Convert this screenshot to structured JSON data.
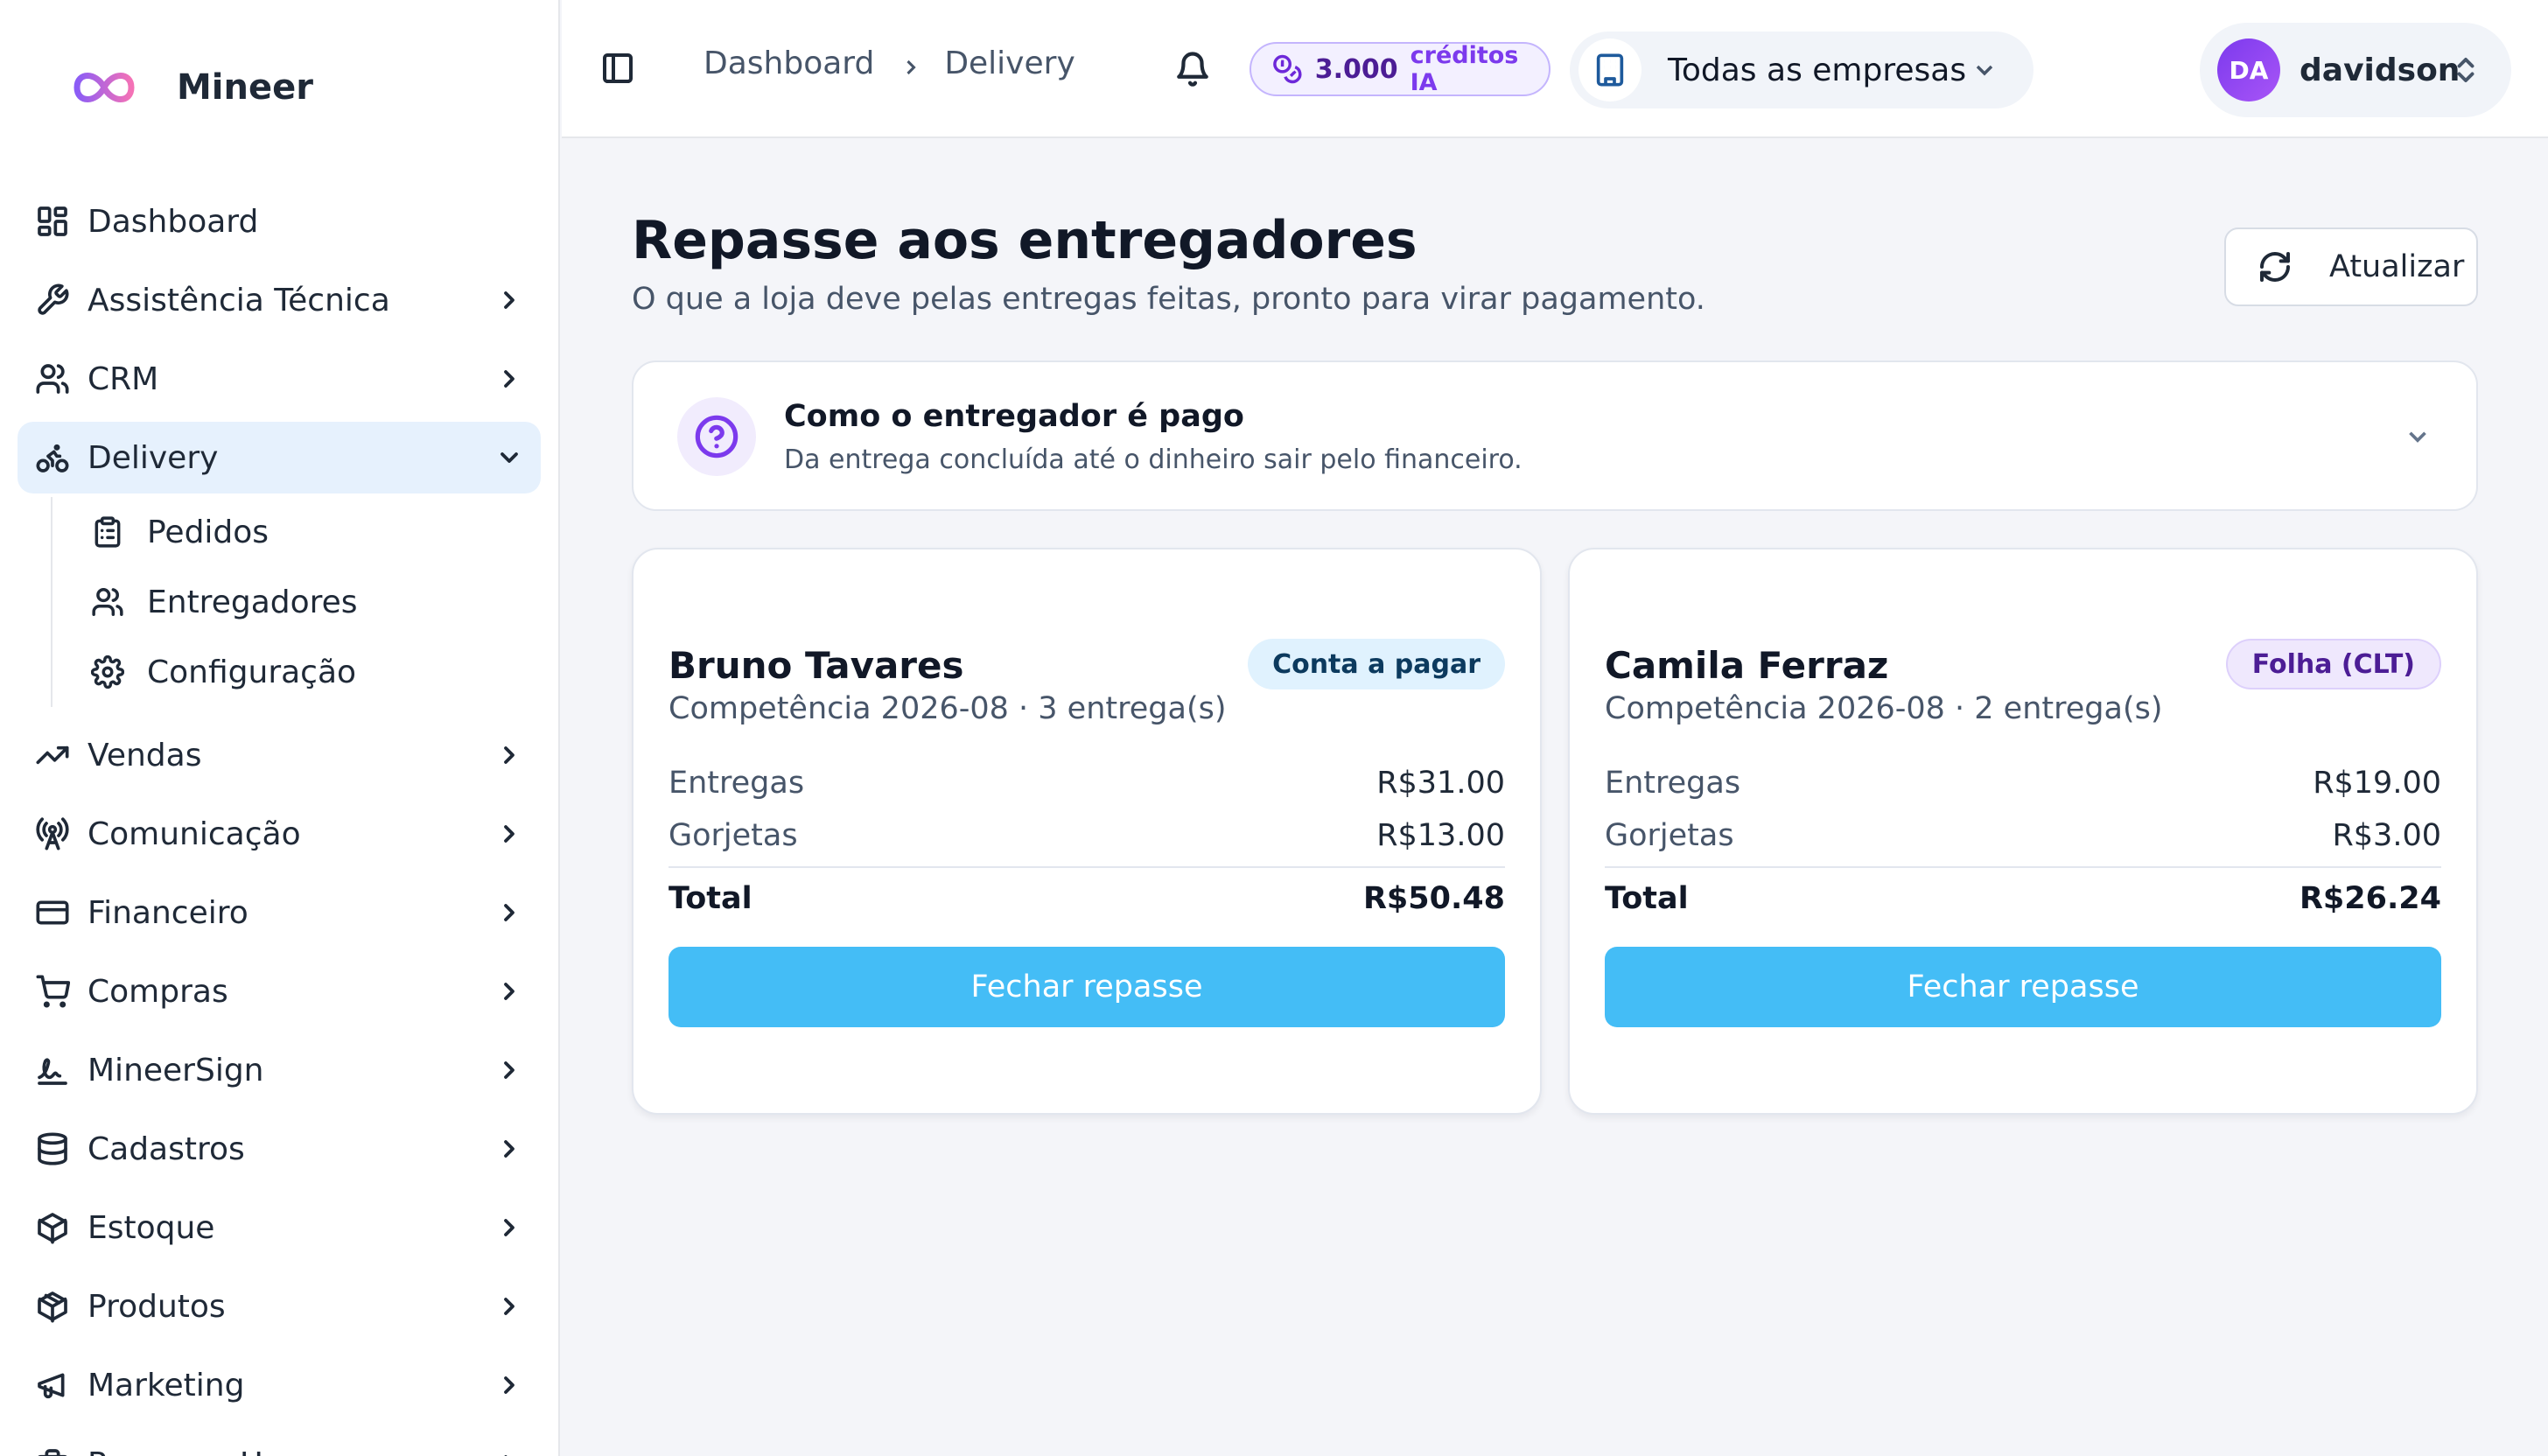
{
  "brand": {
    "name": "Mineer"
  },
  "sidebar": {
    "items": [
      {
        "label": "Dashboard",
        "icon": "layout-grid-icon"
      },
      {
        "label": "Assistência Técnica",
        "icon": "wrench-icon"
      },
      {
        "label": "CRM",
        "icon": "users-icon"
      },
      {
        "label": "Delivery",
        "icon": "bike-icon",
        "expanded": true,
        "children": [
          {
            "label": "Pedidos",
            "icon": "clipboard-icon"
          },
          {
            "label": "Entregadores",
            "icon": "users-icon"
          },
          {
            "label": "Configuração",
            "icon": "gear-icon"
          }
        ]
      },
      {
        "label": "Vendas",
        "icon": "trending-up-icon"
      },
      {
        "label": "Comunicação",
        "icon": "radio-tower-icon"
      },
      {
        "label": "Financeiro",
        "icon": "credit-card-icon"
      },
      {
        "label": "Compras",
        "icon": "shopping-cart-icon"
      },
      {
        "label": "MineerSign",
        "icon": "signature-icon"
      },
      {
        "label": "Cadastros",
        "icon": "database-icon"
      },
      {
        "label": "Estoque",
        "icon": "box-icon"
      },
      {
        "label": "Produtos",
        "icon": "package-icon"
      },
      {
        "label": "Marketing",
        "icon": "megaphone-icon"
      },
      {
        "label": "Recursos Humanos",
        "icon": "briefcase-icon"
      }
    ]
  },
  "topbar": {
    "breadcrumb": [
      "Dashboard",
      "Delivery"
    ],
    "credits": {
      "amount": "3.000",
      "label": "créditos IA"
    },
    "company": "Todas as empresas",
    "user": {
      "initials": "DA",
      "name": "davidson"
    }
  },
  "main": {
    "title": "Repasse aos entregadores",
    "subtitle": "O que a loja deve pelas entregas feitas, pronto para virar pagamento.",
    "refresh_label": "Atualizar",
    "info": {
      "title": "Como o entregador é pago",
      "description": "Da entrega concluída até o dinheiro sair pelo financeiro."
    },
    "cards": [
      {
        "name": "Bruno Tavares",
        "badge": "Conta a pagar",
        "meta": "Competência 2026-08 · 3 entrega(s)",
        "rows": [
          {
            "label": "Entregas",
            "value": "R$31.00"
          },
          {
            "label": "Gorjetas",
            "value": "R$13.00"
          }
        ],
        "total_label": "Total",
        "total_value": "R$50.48",
        "button": "Fechar repasse"
      },
      {
        "name": "Camila Ferraz",
        "badge": "Folha (CLT)",
        "meta": "Competência 2026-08 · 2 entrega(s)",
        "rows": [
          {
            "label": "Entregas",
            "value": "R$19.00"
          },
          {
            "label": "Gorjetas",
            "value": "R$3.00"
          }
        ],
        "total_label": "Total",
        "total_value": "R$26.24",
        "button": "Fechar repasse"
      }
    ]
  },
  "colors": {
    "accent": "#44bdf6",
    "active_nav_bg": "#e6f1fd",
    "credits_purple": "#7c3aed",
    "badge_pay_bg": "#e0f2fe",
    "badge_clt_bg": "#efe8fd"
  }
}
